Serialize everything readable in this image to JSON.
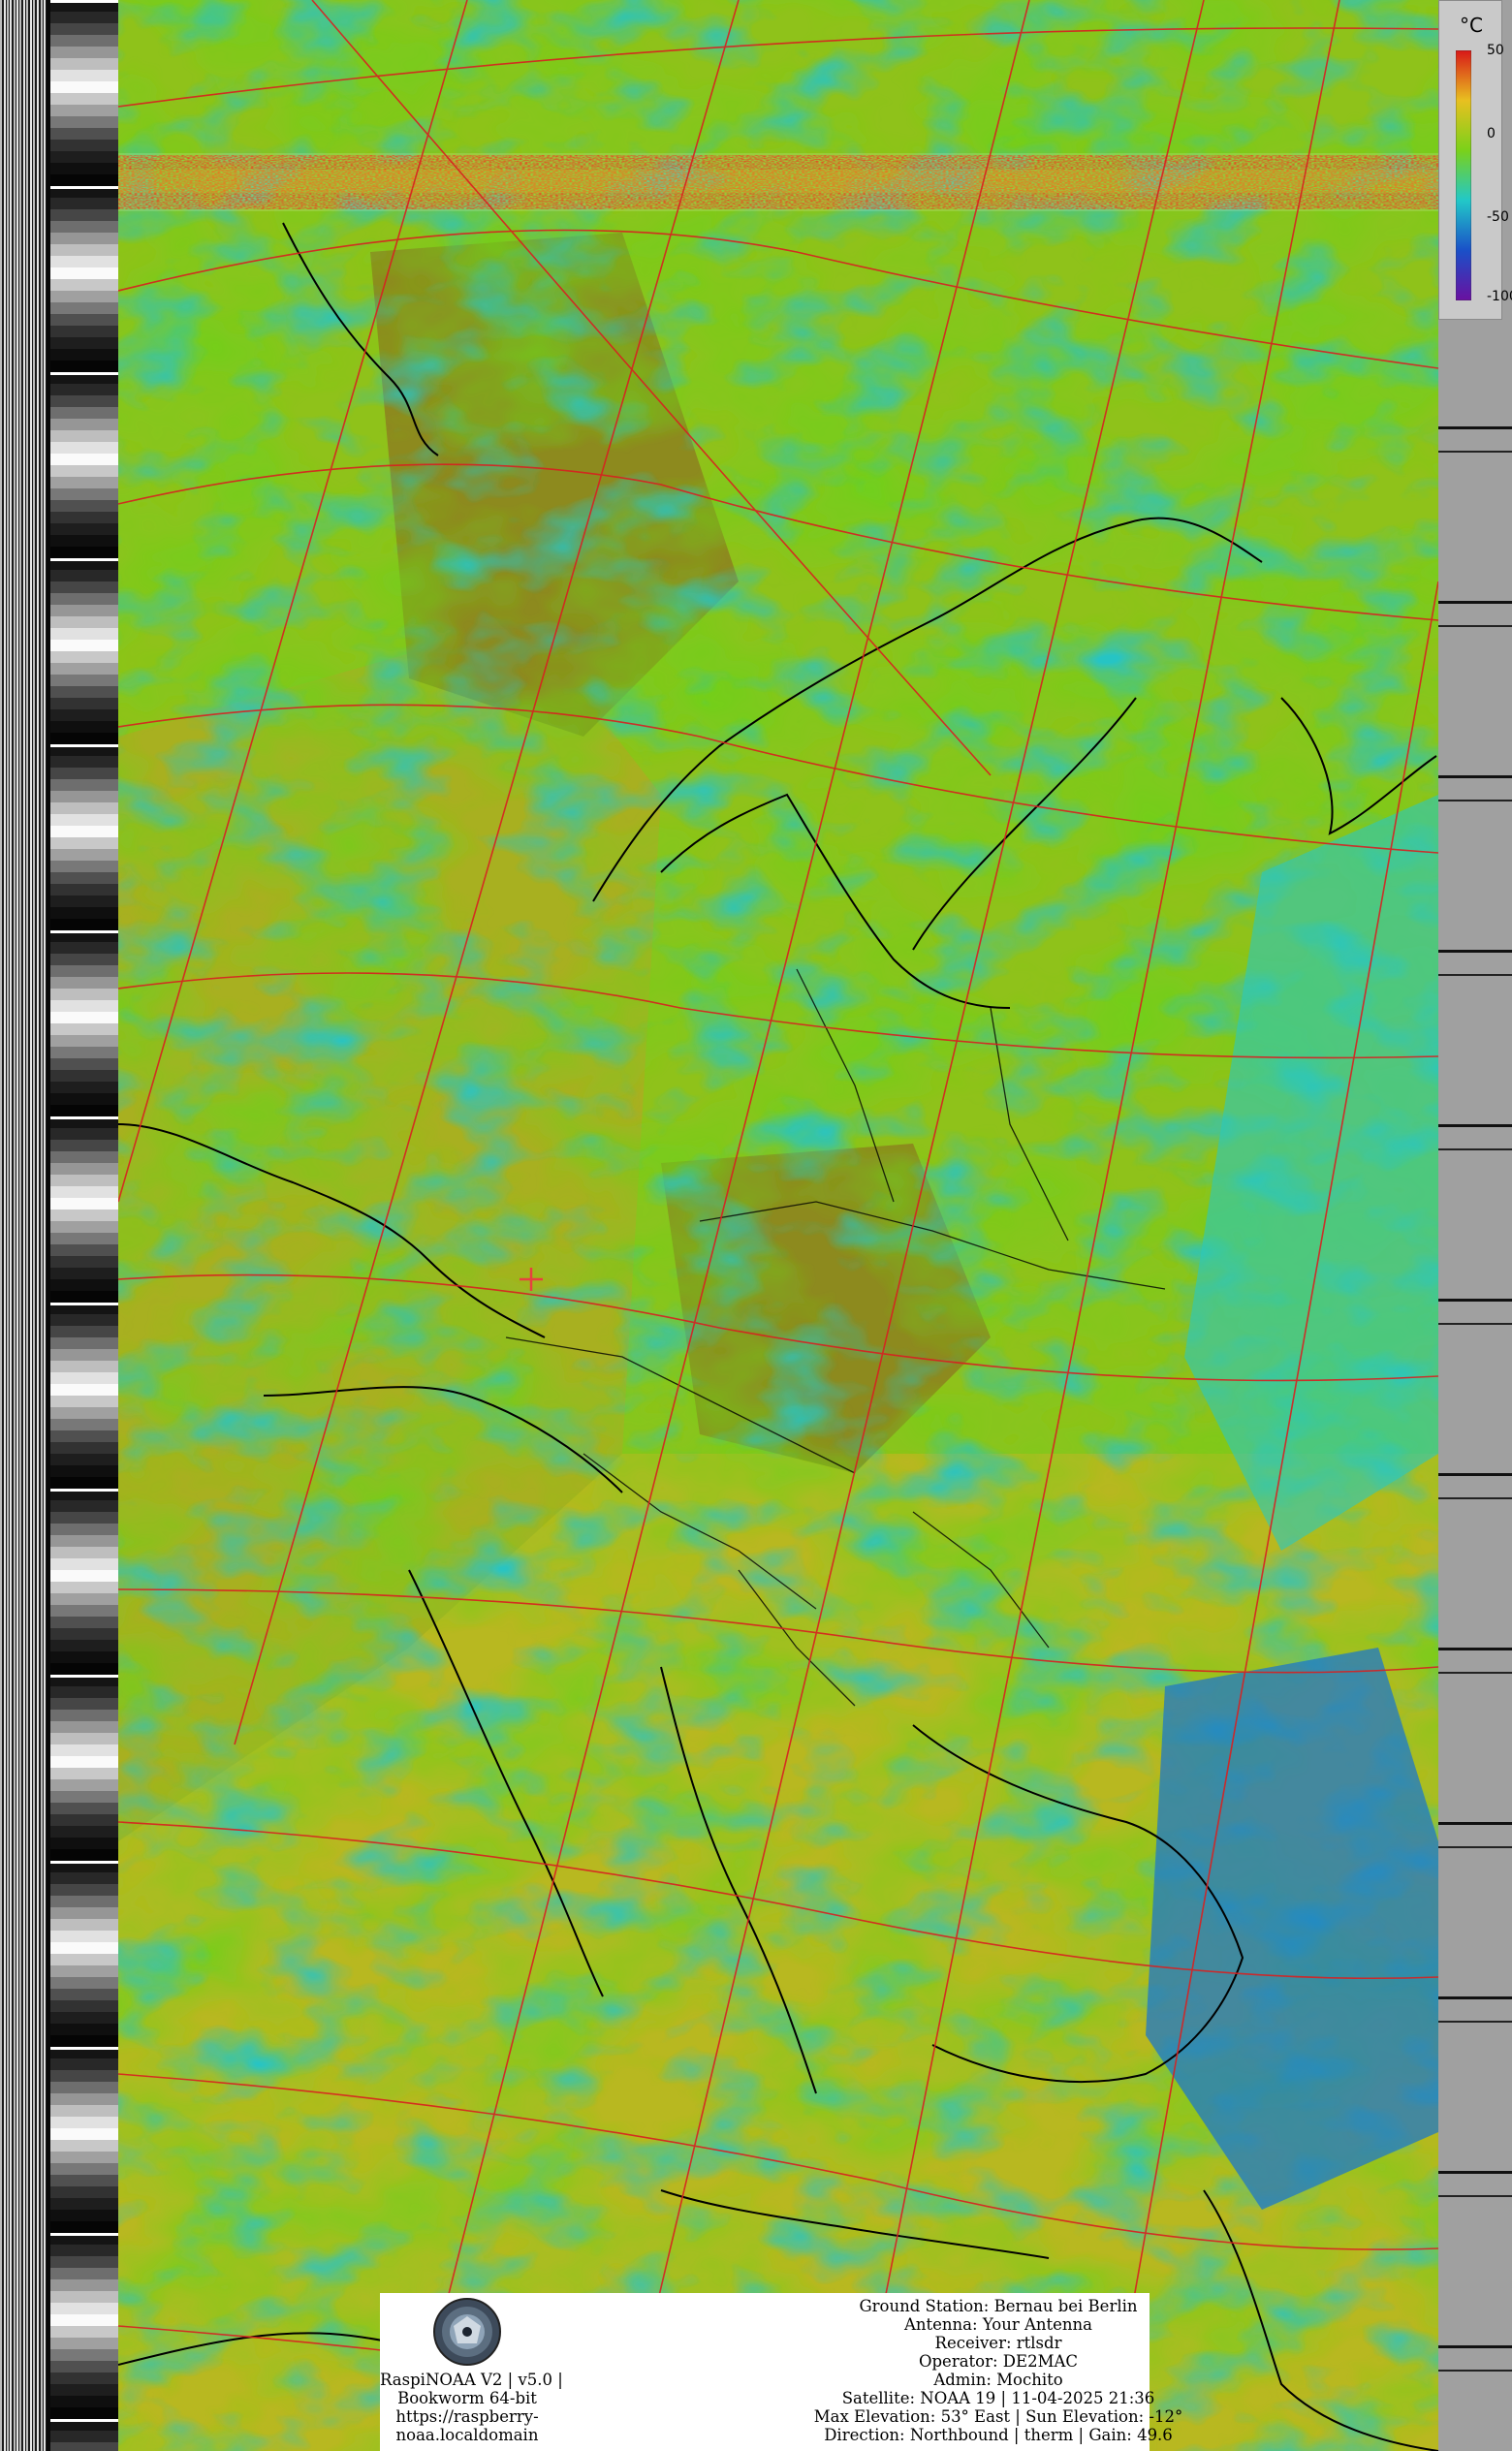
{
  "colorbar": {
    "unit": "°C",
    "ticks": [
      "50",
      "0",
      "-50",
      "-100"
    ],
    "colors": [
      "#d81818",
      "#e8c020",
      "#7ad11a",
      "#22c8c8",
      "#1a50c8",
      "#6a10a0"
    ]
  },
  "footer": {
    "left_lines": [
      "RaspiNOAA V2 | v5.0 |",
      "Bookworm 64-bit",
      "https://raspberry-",
      "noaa.localdomain"
    ],
    "right_lines": [
      "Ground Station: Bernau bei Berlin",
      "Antenna: Your Antenna",
      "Receiver: rtlsdr",
      "Operator: DE2MAC",
      "Admin: Mochito",
      "Satellite: NOAA 19 | 11-04-2025 21:36",
      "Max Elevation: 53° East | Sun Elevation: -12°",
      "Direction: Northbound | therm | Gain: 49.6"
    ]
  },
  "map": {
    "colors": {
      "ocean_warm": "#b8b820",
      "land_warm": "#8fa020",
      "green_cloud": "#7ad11a",
      "cyan_cloud": "#2ac8c0",
      "deep_cloud": "#1a60c0",
      "grid": "#d82020",
      "coast": "#000000",
      "noise": "#e84a20"
    }
  }
}
